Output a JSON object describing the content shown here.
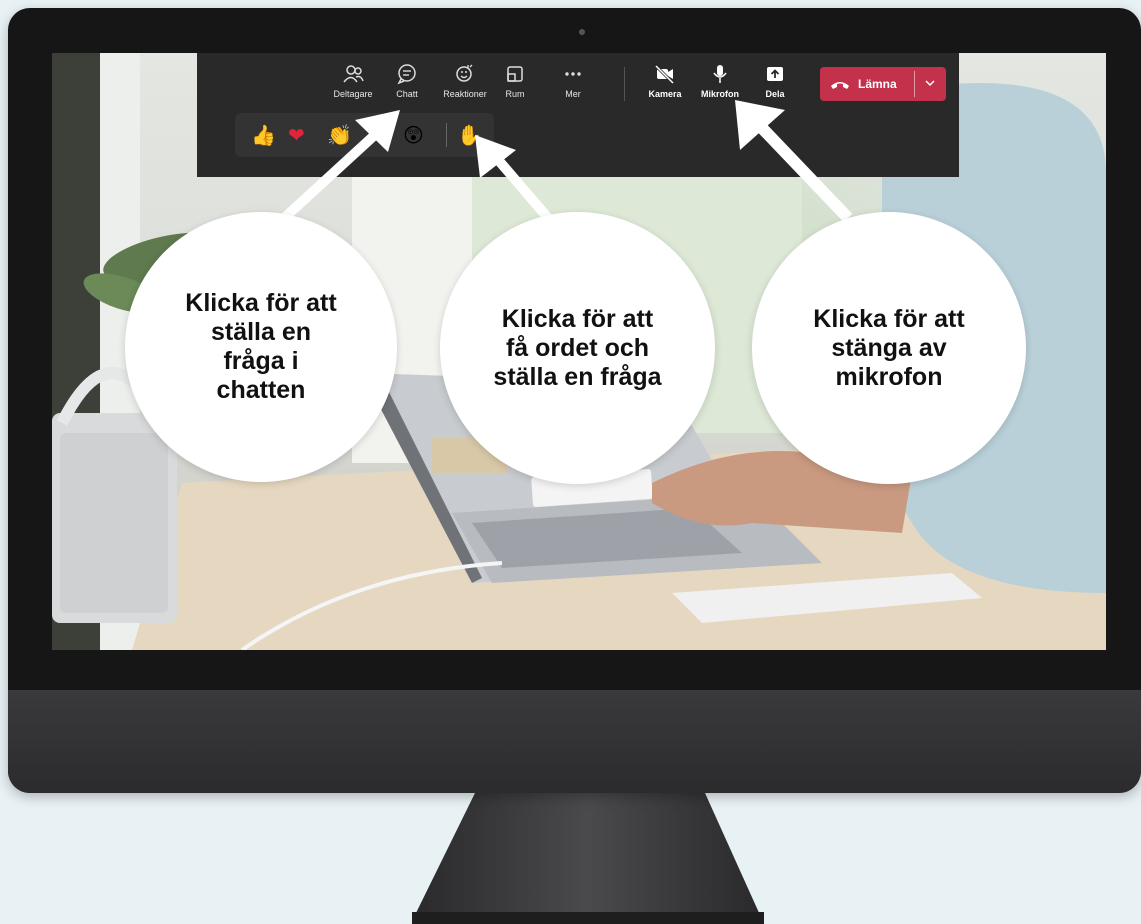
{
  "toolbar": {
    "items": [
      {
        "label": "Deltagare",
        "icon": "participants-icon"
      },
      {
        "label": "Chatt",
        "icon": "chat-icon"
      },
      {
        "label": "Reaktioner",
        "icon": "reactions-icon"
      },
      {
        "label": "Rum",
        "icon": "rooms-icon"
      },
      {
        "label": "Mer",
        "icon": "more-icon"
      },
      {
        "label": "Kamera",
        "icon": "camera-off-icon"
      },
      {
        "label": "Mikrofon",
        "icon": "microphone-icon"
      },
      {
        "label": "Dela",
        "icon": "share-icon"
      }
    ],
    "leave_label": "Lämna"
  },
  "reactions": {
    "emojis": [
      "👍",
      "❤",
      "👏",
      "😲",
      "✋"
    ]
  },
  "callouts": {
    "chat": "Klicka för att\nställa en\nfråga i\nchatten",
    "raise_hand": "Klicka för att\nfå ordet och\nställa en fråga",
    "mic": "Klicka för att\nstänga av\nmikrofon"
  },
  "colors": {
    "toolbar_bg": "#292929",
    "leave_button": "#c4314b",
    "background": "#e8f1f4",
    "callout_bg": "#ffffff"
  }
}
